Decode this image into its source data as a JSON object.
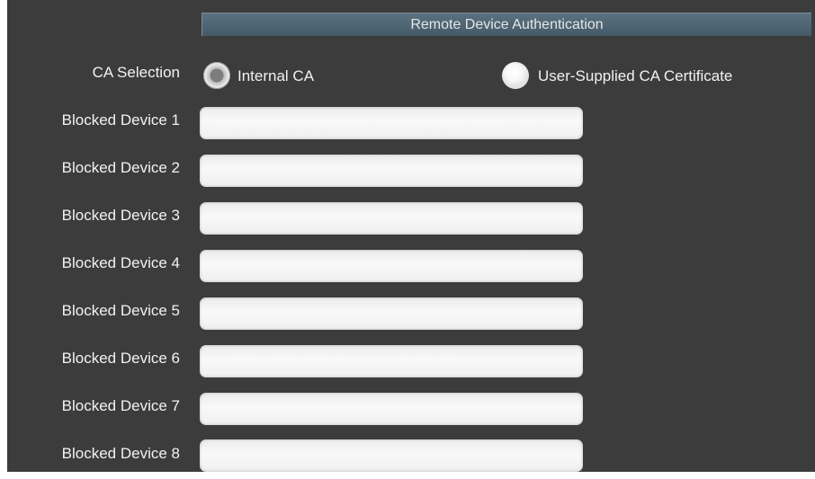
{
  "section": {
    "title": "Remote Device Authentication"
  },
  "ca_selection": {
    "label": "CA Selection",
    "options": [
      {
        "label": "Internal CA",
        "selected": true
      },
      {
        "label": "User-Supplied CA Certificate",
        "selected": false
      }
    ]
  },
  "blocked_devices": [
    {
      "label": "Blocked Device 1",
      "value": ""
    },
    {
      "label": "Blocked Device 2",
      "value": ""
    },
    {
      "label": "Blocked Device 3",
      "value": ""
    },
    {
      "label": "Blocked Device 4",
      "value": ""
    },
    {
      "label": "Blocked Device 5",
      "value": ""
    },
    {
      "label": "Blocked Device 6",
      "value": ""
    },
    {
      "label": "Blocked Device 7",
      "value": ""
    },
    {
      "label": "Blocked Device 8",
      "value": ""
    }
  ]
}
